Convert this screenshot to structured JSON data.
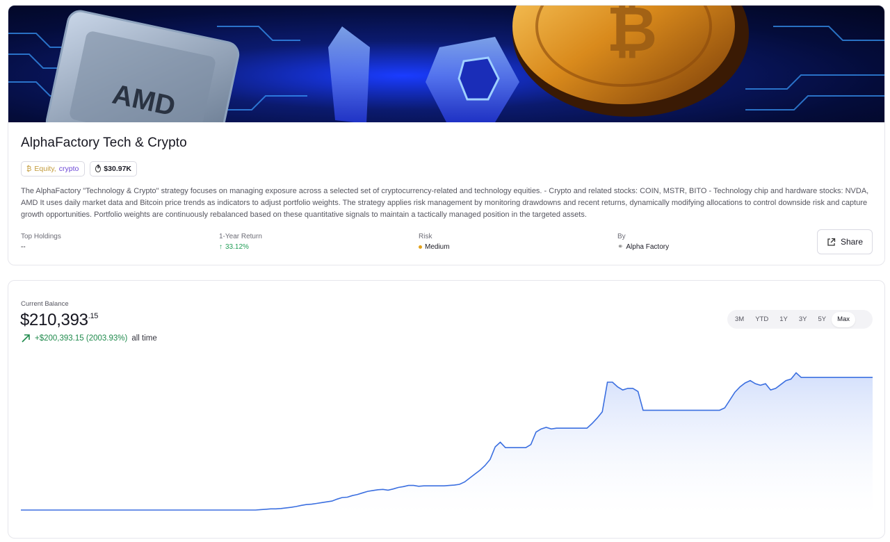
{
  "strategy": {
    "title": "AlphaFactory Tech & Crypto",
    "category_primary": "Equity,",
    "category_secondary": "crypto",
    "value_tag": "$30.97K",
    "description": "The AlphaFactory \"Technology & Crypto\" strategy focuses on managing exposure across a selected set of cryptocurrency-related and technology equities. - Crypto and related stocks: COIN, MSTR, BITO - Technology chip and hardware stocks: NVDA, AMD It uses daily market data and Bitcoin price trends as indicators to adjust portfolio weights. The strategy applies risk management by monitoring drawdowns and recent returns, dynamically modifying allocations to control downside risk and capture growth opportunities. Portfolio weights are continuously rebalanced based on these quantitative signals to maintain a tactically managed position in the targeted assets."
  },
  "banner": {
    "chip_text": "AMD"
  },
  "meta": {
    "holdings_label": "Top Holdings",
    "holdings_value": "--",
    "return_label": "1-Year Return",
    "return_value": "33.12%",
    "risk_label": "Risk",
    "risk_value": "Medium",
    "risk_color": "#e3a21a",
    "by_label": "By",
    "by_value": "Alpha Factory"
  },
  "share_label": "Share",
  "balance": {
    "label": "Current Balance",
    "main": "$210,393",
    "cents": ".15",
    "gain": "+$200,393.15 (2003.93%)",
    "suffix": "all time"
  },
  "ranges": [
    "3M",
    "YTD",
    "1Y",
    "3Y",
    "5Y",
    "Max"
  ],
  "active_range": "Max",
  "colors": {
    "line": "#3b6fe0",
    "positive": "#1f8a4c",
    "accent": "#6b46d6"
  },
  "chart_data": {
    "type": "area",
    "title": "",
    "xlabel": "",
    "ylabel": "",
    "grid": false,
    "y": [
      10000,
      10000,
      10000,
      10000,
      10000,
      10000,
      10000,
      10000,
      10000,
      10000,
      10000,
      10000,
      10000,
      10000,
      10000,
      10000,
      10000,
      10000,
      10000,
      10000,
      10000,
      10000,
      10000,
      10000,
      10000,
      10000,
      10000,
      10000,
      10000,
      10000,
      10000,
      10000,
      10000,
      10000,
      10000,
      10000,
      10000,
      10000,
      10000,
      10000,
      10000,
      10000,
      10000,
      10000,
      10000,
      10000,
      10000,
      10500,
      11000,
      11500,
      11500,
      12000,
      12800,
      13500,
      14500,
      16000,
      17000,
      17500,
      18500,
      19500,
      20500,
      21500,
      24000,
      26000,
      26500,
      28500,
      30000,
      32000,
      34000,
      35000,
      36000,
      36500,
      35500,
      37000,
      39000,
      40000,
      41500,
      41500,
      40500,
      41000,
      41000,
      41000,
      41000,
      41000,
      41500,
      42000,
      43000,
      46000,
      51000,
      56000,
      61000,
      67000,
      75000,
      91000,
      97000,
      90000,
      90000,
      90000,
      90000,
      90000,
      94000,
      110000,
      114000,
      116000,
      114000,
      115000,
      115000,
      115000,
      115000,
      115000,
      115000,
      115000,
      121000,
      128000,
      136000,
      174000,
      174000,
      168000,
      164000,
      166000,
      166000,
      162000,
      138000,
      138000,
      138000,
      138000,
      138000,
      138000,
      138000,
      138000,
      138000,
      138000,
      138000,
      138000,
      138000,
      138000,
      138000,
      138000,
      141000,
      151000,
      161000,
      168000,
      173000,
      176000,
      172000,
      170000,
      172000,
      164000,
      166000,
      171000,
      176000,
      178000,
      186000,
      180000,
      180000,
      180000,
      180000,
      180000,
      180000,
      180000,
      180000,
      180000,
      180000,
      180000,
      180000,
      180000,
      180000,
      180000
    ]
  }
}
